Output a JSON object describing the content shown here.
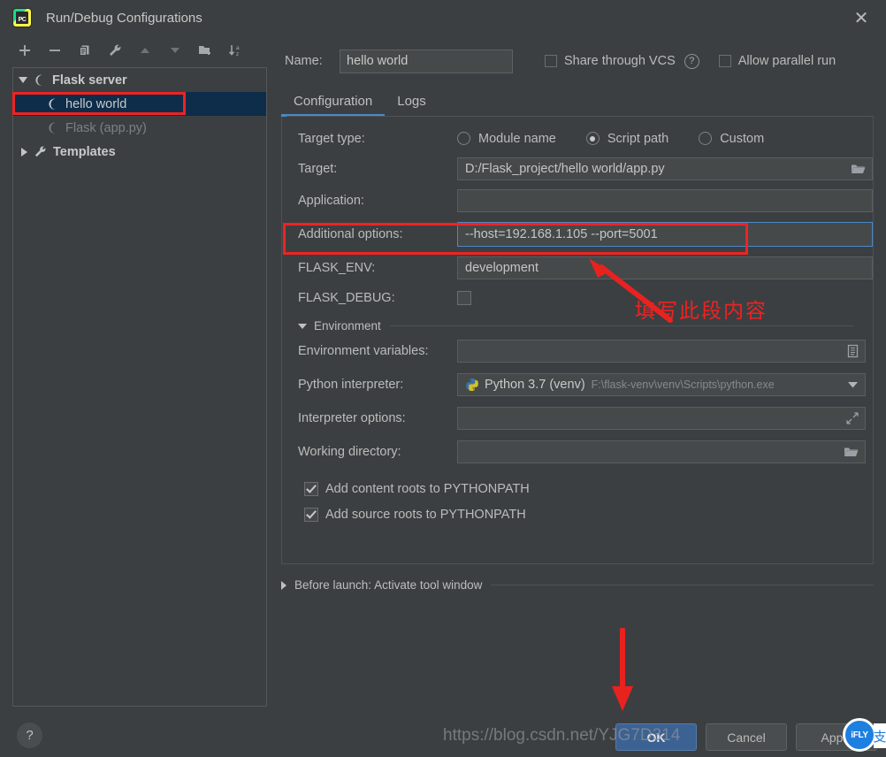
{
  "window": {
    "title": "Run/Debug Configurations",
    "logo_text": "PC",
    "close_icon": "close-icon"
  },
  "sidebar": {
    "toolbar": [
      {
        "name": "add-configuration-button",
        "icon": "plus-icon",
        "label": "+"
      },
      {
        "name": "remove-configuration-button",
        "icon": "minus-icon",
        "label": "-"
      },
      {
        "name": "copy-configuration-button",
        "icon": "copy-icon",
        "label": "copy"
      },
      {
        "name": "edit-templates-button",
        "icon": "wrench-icon",
        "label": "wrench"
      },
      {
        "name": "move-up-button",
        "icon": "arrow-up-icon",
        "label": "up"
      },
      {
        "name": "move-down-button",
        "icon": "arrow-down-icon",
        "label": "down"
      },
      {
        "name": "new-folder-button",
        "icon": "folder-add-icon",
        "label": "folder"
      },
      {
        "name": "sort-configurations-button",
        "icon": "sort-az-icon",
        "label": "sort"
      }
    ],
    "tree": [
      {
        "label": "Flask server",
        "type": "group",
        "expanded": true,
        "icon": "flask-icon"
      },
      {
        "label": "hello world",
        "type": "child",
        "selected": true,
        "icon": "flask-icon"
      },
      {
        "label": "Flask (app.py)",
        "type": "child",
        "dimmed": true,
        "icon": "flask-icon"
      },
      {
        "label": "Templates",
        "type": "group",
        "expanded": false,
        "icon": "wrench-icon"
      }
    ],
    "help_label": "?"
  },
  "header": {
    "name_label": "Name:",
    "name_value": "hello world",
    "share_vcs_label": "Share through VCS",
    "share_vcs_checked": false,
    "help_icon_label": "?",
    "allow_parallel_label": "Allow parallel run",
    "allow_parallel_checked": false
  },
  "tabs": [
    {
      "label": "Configuration",
      "active": true
    },
    {
      "label": "Logs",
      "active": false
    }
  ],
  "form": {
    "target_type_label": "Target type:",
    "target_type_options": [
      {
        "label": "Module name",
        "selected": false
      },
      {
        "label": "Script path",
        "selected": true
      },
      {
        "label": "Custom",
        "selected": false
      }
    ],
    "target_label": "Target:",
    "target_value": "D:/Flask_project/hello world/app.py",
    "target_icon": "folder-icon",
    "application_label": "Application:",
    "application_value": "",
    "additional_options_label": "Additional options:",
    "additional_options_value": "--host=192.168.1.105 --port=5001",
    "flask_env_label": "FLASK_ENV:",
    "flask_env_value": "development",
    "flask_debug_label": "FLASK_DEBUG:",
    "flask_debug_checked": false
  },
  "environment": {
    "section_label": "Environment",
    "env_vars_label": "Environment variables:",
    "env_vars_value": "",
    "env_vars_icon": "list-edit-icon",
    "interpreter_label": "Python interpreter:",
    "interpreter_name": "Python 3.7 (venv)",
    "interpreter_path": "F:\\flask-venv\\venv\\Scripts\\python.exe",
    "interpreter_icon": "python-icon",
    "interpreter_dropdown_icon": "chevron-down-icon",
    "interpreter_options_label": "Interpreter options:",
    "interpreter_options_value": "",
    "interpreter_options_icon": "expand-icon",
    "working_dir_label": "Working directory:",
    "working_dir_value": "",
    "working_dir_icon": "folder-icon",
    "add_content_roots_label": "Add content roots to PYTHONPATH",
    "add_content_roots_checked": true,
    "add_source_roots_label": "Add source roots to PYTHONPATH",
    "add_source_roots_checked": true
  },
  "before_launch": {
    "label": "Before launch: Activate tool window",
    "expanded": false
  },
  "footer": {
    "ok_label": "OK",
    "cancel_label": "Cancel",
    "apply_label": "Apply"
  },
  "annotations": {
    "chinese_note": "填写此段内容",
    "watermark": "https://blog.csdn.net/YJG7D314",
    "badge_label": "iFLY",
    "badge_tail": "支",
    "highlight_color": "#ef2323",
    "arrow_color": "#e8221f"
  },
  "colors": {
    "dialog_bg": "#3c3f41",
    "field_bg": "#45494a",
    "selection_bg": "#0d2d4a",
    "accent_blue": "#4a88c7",
    "primary_button": "#3c6293"
  }
}
